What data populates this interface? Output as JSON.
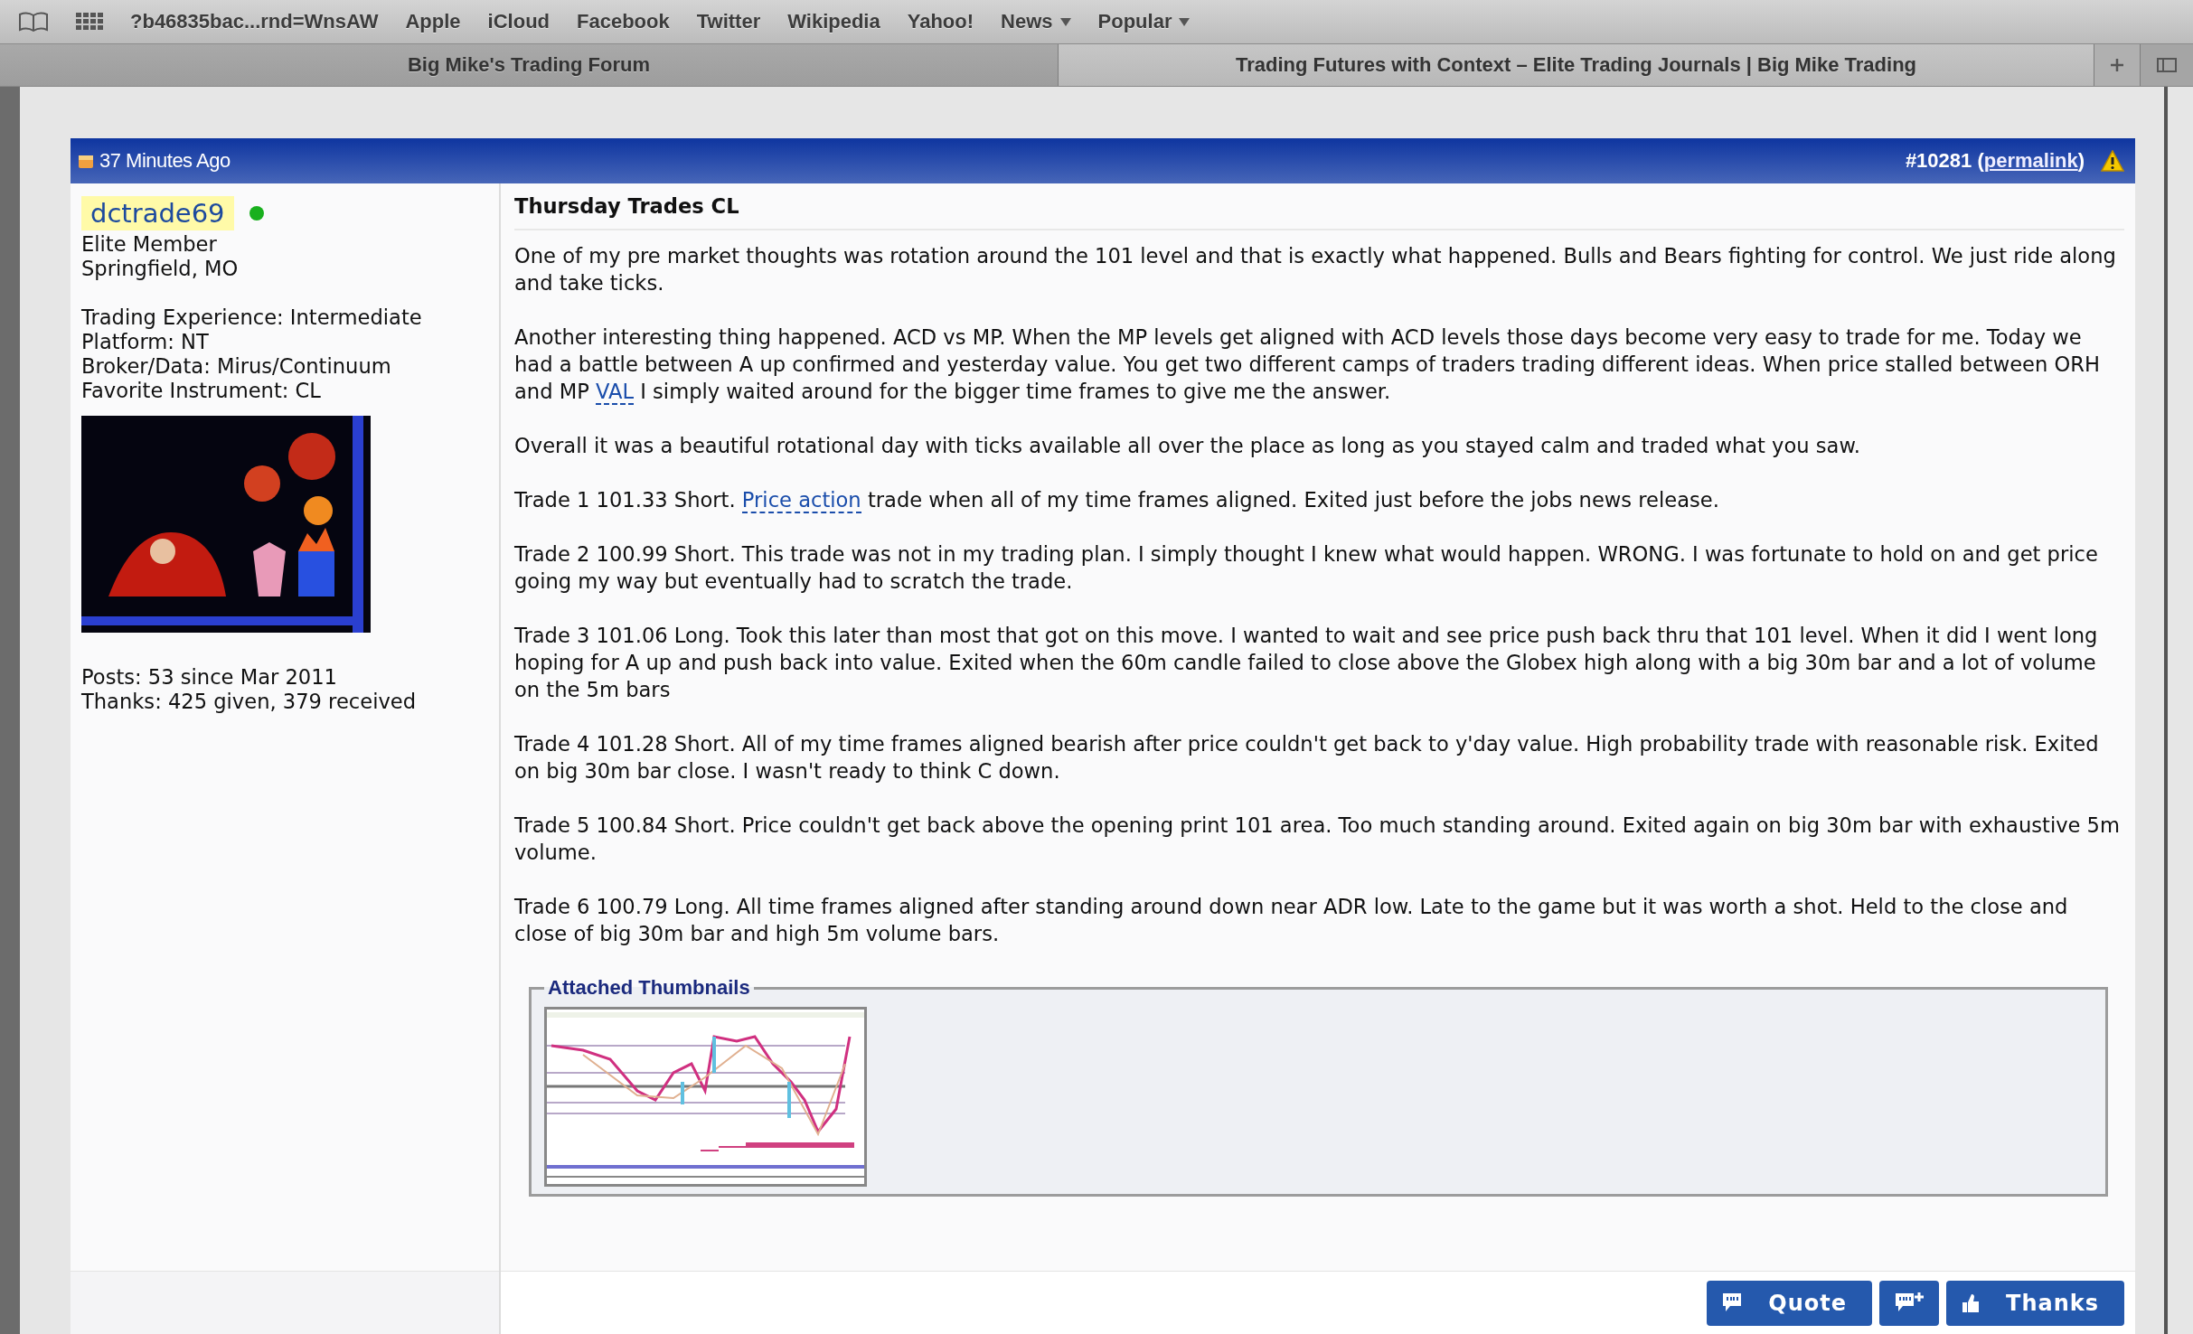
{
  "bookmarks": [
    {
      "label": "?b46835bac...rnd=WnsAW",
      "menu": false
    },
    {
      "label": "Apple",
      "menu": false
    },
    {
      "label": "iCloud",
      "menu": false
    },
    {
      "label": "Facebook",
      "menu": false
    },
    {
      "label": "Twitter",
      "menu": false
    },
    {
      "label": "Wikipedia",
      "menu": false
    },
    {
      "label": "Yahoo!",
      "menu": false
    },
    {
      "label": "News",
      "menu": true
    },
    {
      "label": "Popular",
      "menu": true
    }
  ],
  "tabs": [
    {
      "label": "Big Mike's Trading Forum",
      "selected": false
    },
    {
      "label": "Trading Futures with Context – Elite Trading Journals | Big Mike Trading",
      "selected": true
    }
  ],
  "post": {
    "time": "37 Minutes Ago",
    "number": {
      "before": "#10281 (",
      "link": "permalink",
      "after": ")"
    },
    "user": {
      "name": "dctrade69",
      "online": true,
      "title": "Elite Member",
      "location": "Springfield, MO",
      "details": [
        "Trading Experience: Intermediate",
        "Platform: NT",
        "Broker/Data: Mirus/Continuum",
        "Favorite Instrument: CL"
      ],
      "avatar": {
        "kind": "picture"
      },
      "stats": [
        "Posts: 53 since Mar 2011",
        "Thanks: 425 given, 379 received"
      ]
    },
    "title": "Thursday Trades CL",
    "paragraphs": [
      [
        {
          "kind": "text",
          "text": "One of my pre market thoughts was rotation around the 101 level and that is exactly what happened. Bulls and Bears fighting for control. We just ride along and take ticks."
        }
      ],
      [
        {
          "kind": "text",
          "text": "Another interesting thing happened. ACD vs MP. When the MP levels get aligned with ACD levels those days become very easy to trade for me. Today we had a battle between A up confirmed and yesterday value. You get two different camps of traders trading different ideas. When price stalled between ORH and MP "
        },
        {
          "kind": "link",
          "text": "VAL"
        },
        {
          "kind": "text",
          "text": " I simply waited around for the bigger time frames to give me the answer."
        }
      ],
      [
        {
          "kind": "text",
          "text": "Overall it was a beautiful rotational day with ticks available all over the place as long as you stayed calm and traded what you saw."
        }
      ],
      [
        {
          "kind": "text",
          "text": "Trade 1 101.33 Short. "
        },
        {
          "kind": "link",
          "text": "Price action"
        },
        {
          "kind": "text",
          "text": " trade when all of my time frames aligned. Exited just before the jobs news release."
        }
      ],
      [
        {
          "kind": "text",
          "text": "Trade 2 100.99 Short. This trade was not in my trading plan. I simply thought I knew what would happen. WRONG. I was fortunate to hold on and get price going my way but eventually had to scratch the trade."
        }
      ],
      [
        {
          "kind": "text",
          "text": "Trade 3 101.06 Long. Took this later than most that got on this move. I wanted to wait and see price push back thru that 101 level. When it did I went long hoping for A up and push back into value. Exited when the 60m candle failed to close above the Globex high along with a big 30m bar and a lot of volume on the 5m bars"
        }
      ],
      [
        {
          "kind": "text",
          "text": "Trade 4 101.28 Short. All of my time frames aligned bearish after price couldn't get back to y'day value. High probability trade with reasonable risk. Exited on big 30m bar close. I wasn't ready to think C down."
        }
      ],
      [
        {
          "kind": "text",
          "text": "Trade 5 100.84 Short. Price couldn't get back above the opening print 101 area. Too much standing around. Exited again on big 30m bar with exhaustive 5m volume."
        }
      ],
      [
        {
          "kind": "text",
          "text": "Trade 6 100.79 Long. All time frames aligned after standing around down near ADR low. Late to the game but it was worth a shot. Held to the close and close of big 30m bar and high 5m volume bars."
        }
      ]
    ],
    "attachments": {
      "legend": "Attached Thumbnails",
      "thumbnails": [
        {
          "kind": "picture"
        }
      ]
    },
    "buttons": [
      {
        "kind": "quote",
        "label": "Quote"
      },
      {
        "kind": "multiquote"
      },
      {
        "kind": "thanks",
        "label": "Thanks"
      }
    ]
  }
}
